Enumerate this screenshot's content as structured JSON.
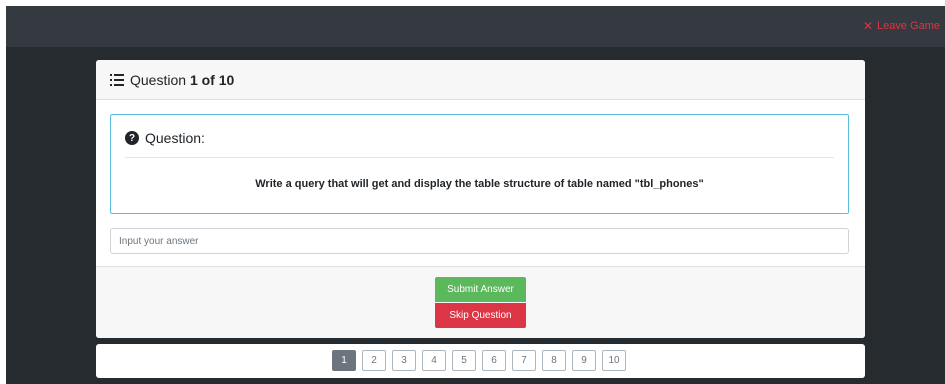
{
  "topbar": {
    "leave_label": "Leave Game",
    "leave_icon": "close-icon"
  },
  "card": {
    "header": {
      "prefix": "Question",
      "current": "1",
      "sep": "of",
      "total": "10",
      "icon": "list-icon"
    },
    "question": {
      "title": "Question:",
      "icon": "question-circle-icon",
      "text": "Write a query that will get and display the table structure of table named \"tbl_phones\""
    },
    "answer": {
      "placeholder": "Input your answer",
      "value": ""
    },
    "buttons": {
      "submit": "Submit Answer",
      "skip": "Skip Question"
    }
  },
  "pagination": {
    "active": "1",
    "pages": [
      "1",
      "2",
      "3",
      "4",
      "5",
      "6",
      "7",
      "8",
      "9",
      "10"
    ]
  },
  "colors": {
    "topbar": "#343a40",
    "background": "#262b30",
    "leave": "#dc3545",
    "question_border": "#5bc0de",
    "submit": "#5cb85c",
    "skip": "#dc3545"
  }
}
